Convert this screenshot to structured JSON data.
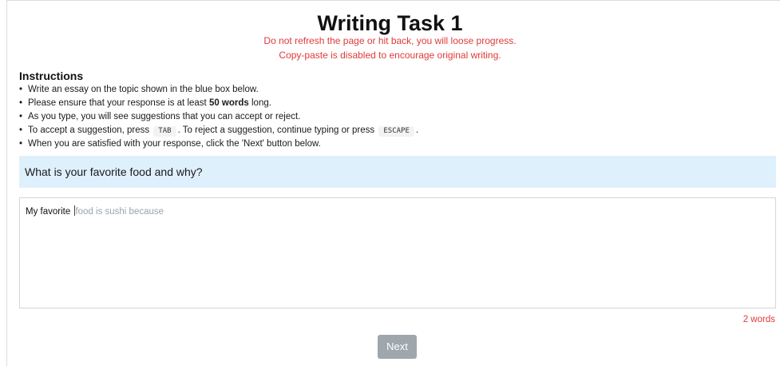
{
  "page": {
    "title": "Writing Task 1",
    "warning_refresh": "Do not refresh the page or hit back, you will loose progress.",
    "warning_copy": "Copy-paste is disabled to encourage original writing."
  },
  "instructions": {
    "heading": "Instructions",
    "item1": "Write an essay on the topic shown in the blue box below.",
    "item2_pre": "Please ensure that your response is at least ",
    "item2_bold": "50 words",
    "item2_post": " long.",
    "item3": "As you type, you will see suggestions that you can accept or reject.",
    "item4_pre": "To accept a suggestion, press ",
    "item4_key1": "TAB",
    "item4_mid": ". To reject a suggestion, continue typing or press ",
    "item4_key2": "ESCAPE",
    "item4_post": ".",
    "item5": "When you are satisfied with your response, click the 'Next' button below."
  },
  "prompt": {
    "text": "What is your favorite food and why?"
  },
  "editor": {
    "typed_text": "My favorite ",
    "suggestion_text": "food is sushi because"
  },
  "status": {
    "word_count": "2 words"
  },
  "actions": {
    "next_label": "Next"
  },
  "colors": {
    "warning": "#e03a3a",
    "prompt_background": "#dff0fd",
    "suggestion": "#9aa3ad",
    "next_button_disabled": "#9ea6ae"
  }
}
